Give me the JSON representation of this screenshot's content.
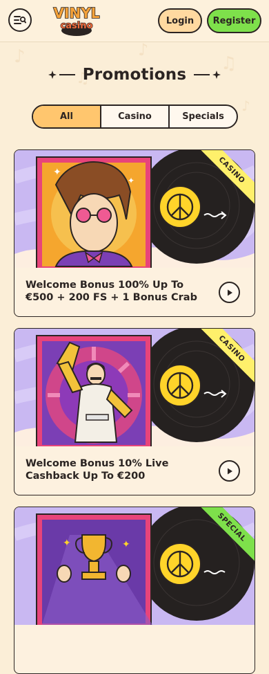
{
  "header": {
    "logo_text_top": "VINYL",
    "logo_text_bottom": "casino",
    "login_label": "Login",
    "register_label": "Register"
  },
  "page": {
    "title": "Promotions"
  },
  "tabs": [
    {
      "label": "All",
      "selected": true
    },
    {
      "label": "Casino",
      "selected": false
    },
    {
      "label": "Specials",
      "selected": false
    }
  ],
  "promos": [
    {
      "title": "Welcome Bonus 100% Up To €500 + 200 FS + 1 Bonus Crab",
      "badge": "CASINO",
      "badge_color": "#fff06b"
    },
    {
      "title": "Welcome Bonus 10% Live Cashback Up To €200",
      "badge": "CASINO",
      "badge_color": "#fff06b"
    },
    {
      "title": "",
      "badge": "SPECIAL",
      "badge_color": "#7ee04b"
    }
  ],
  "colors": {
    "background": "#fbeed7",
    "accent_orange": "#ffc66e",
    "register_green": "#7ee04b",
    "card_purple": "#c9b8f2",
    "record_label": "#ffd42a"
  }
}
